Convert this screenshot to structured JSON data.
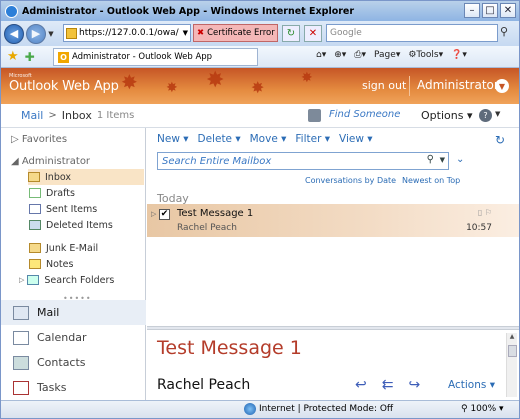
{
  "browser": {
    "window_title": "Administrator - Outlook Web App - Windows Internet Explorer",
    "url": "https://127.0.0.1/owa/",
    "cert_error": "Certificate Error",
    "search_placeholder": "Google",
    "tab_title": "Administrator - Outlook Web App",
    "page_menu": "Page",
    "tools_menu": "Tools",
    "status_zone": "Internet | Protected Mode: Off",
    "zoom": "100%"
  },
  "owa": {
    "brand_small": "Microsoft",
    "brand": "Outlook Web App",
    "sign_out": "sign out",
    "user": "Administrator",
    "breadcrumb_mail": "Mail",
    "breadcrumb_inbox": "Inbox",
    "inbox_count": "1 Items",
    "find_someone": "Find Someone",
    "options": "Options"
  },
  "nav": {
    "favorites": "Favorites",
    "mailbox": "Administrator",
    "folders": [
      "Inbox",
      "Drafts",
      "Sent Items",
      "Deleted Items",
      "Junk E-Mail",
      "Notes",
      "Search Folders"
    ],
    "sections": [
      "Mail",
      "Calendar",
      "Contacts",
      "Tasks"
    ]
  },
  "toolbar": {
    "new": "New",
    "delete": "Delete",
    "move": "Move",
    "filter": "Filter",
    "view": "View",
    "search_placeholder": "Search Entire Mailbox",
    "sort_by": "Conversations by Date",
    "sort_order": "Newest on Top"
  },
  "list": {
    "group": "Today",
    "messages": [
      {
        "subject": "Test Message 1",
        "from": "Rachel Peach",
        "time": "10:57"
      }
    ]
  },
  "reading": {
    "title": "Test Message 1",
    "from": "Rachel Peach",
    "actions": "Actions"
  }
}
